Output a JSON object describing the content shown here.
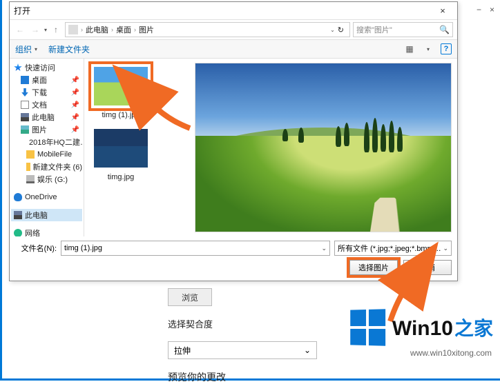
{
  "outer": {
    "minimize": "−",
    "close": "×"
  },
  "dialog": {
    "title": "打开",
    "close": "×",
    "nav": {
      "back": "←",
      "forward": "→",
      "up": "↑",
      "crumbs": [
        "此电脑",
        "桌面",
        "图片"
      ],
      "dropdown": "⌄",
      "refresh": "↻"
    },
    "search": {
      "placeholder": "搜索\"图片\"",
      "icon": "🔍"
    },
    "toolbar": {
      "organize": "组织",
      "chev": "▾",
      "newfolder": "新建文件夹",
      "view": "▦",
      "viewchev": "▾",
      "help": "?"
    },
    "tree": [
      {
        "icon": "ic-star",
        "label": "快速访问"
      },
      {
        "icon": "ic-desktop",
        "label": "桌面",
        "pin": true,
        "sub": true
      },
      {
        "icon": "ic-dl",
        "label": "下载",
        "pin": true,
        "sub": true
      },
      {
        "icon": "ic-doc",
        "label": "文档",
        "pin": true,
        "sub": true
      },
      {
        "icon": "ic-pc",
        "label": "此电脑",
        "pin": true,
        "sub": true
      },
      {
        "icon": "ic-img",
        "label": "图片",
        "pin": true,
        "sub": true
      },
      {
        "icon": "ic-fold",
        "label": "2018年HQ二建…",
        "sub2": true
      },
      {
        "icon": "ic-fold",
        "label": "MobileFile",
        "sub2": true
      },
      {
        "icon": "ic-fold",
        "label": "新建文件夹 (6)",
        "sub2": true
      },
      {
        "icon": "ic-hdd",
        "label": "娱乐 (G:)",
        "sub2": true
      },
      {
        "icon": "ic-cloud",
        "label": "OneDrive"
      },
      {
        "icon": "ic-pc",
        "label": "此电脑",
        "sel": true
      },
      {
        "icon": "ic-net",
        "label": "网络"
      }
    ],
    "files": [
      {
        "name": "timg (1).jpg",
        "sel": true,
        "thumb": "land1"
      },
      {
        "name": "timg.jpg",
        "thumb": "land2"
      }
    ],
    "filename_label": "文件名(N):",
    "filename_value": "timg (1).jpg",
    "filetype": "所有文件 (*.jpg;*.jpeg;*.bmp;*.…",
    "open_btn": "选择图片",
    "cancel_btn": "取消"
  },
  "parent": {
    "browse": "浏览",
    "fit_label": "选择契合度",
    "fit_value": "拉伸",
    "preview_label": "预览你的更改"
  },
  "brand": {
    "text": "Win10",
    "suffix": "之家",
    "url": "www.win10xitong.com"
  }
}
